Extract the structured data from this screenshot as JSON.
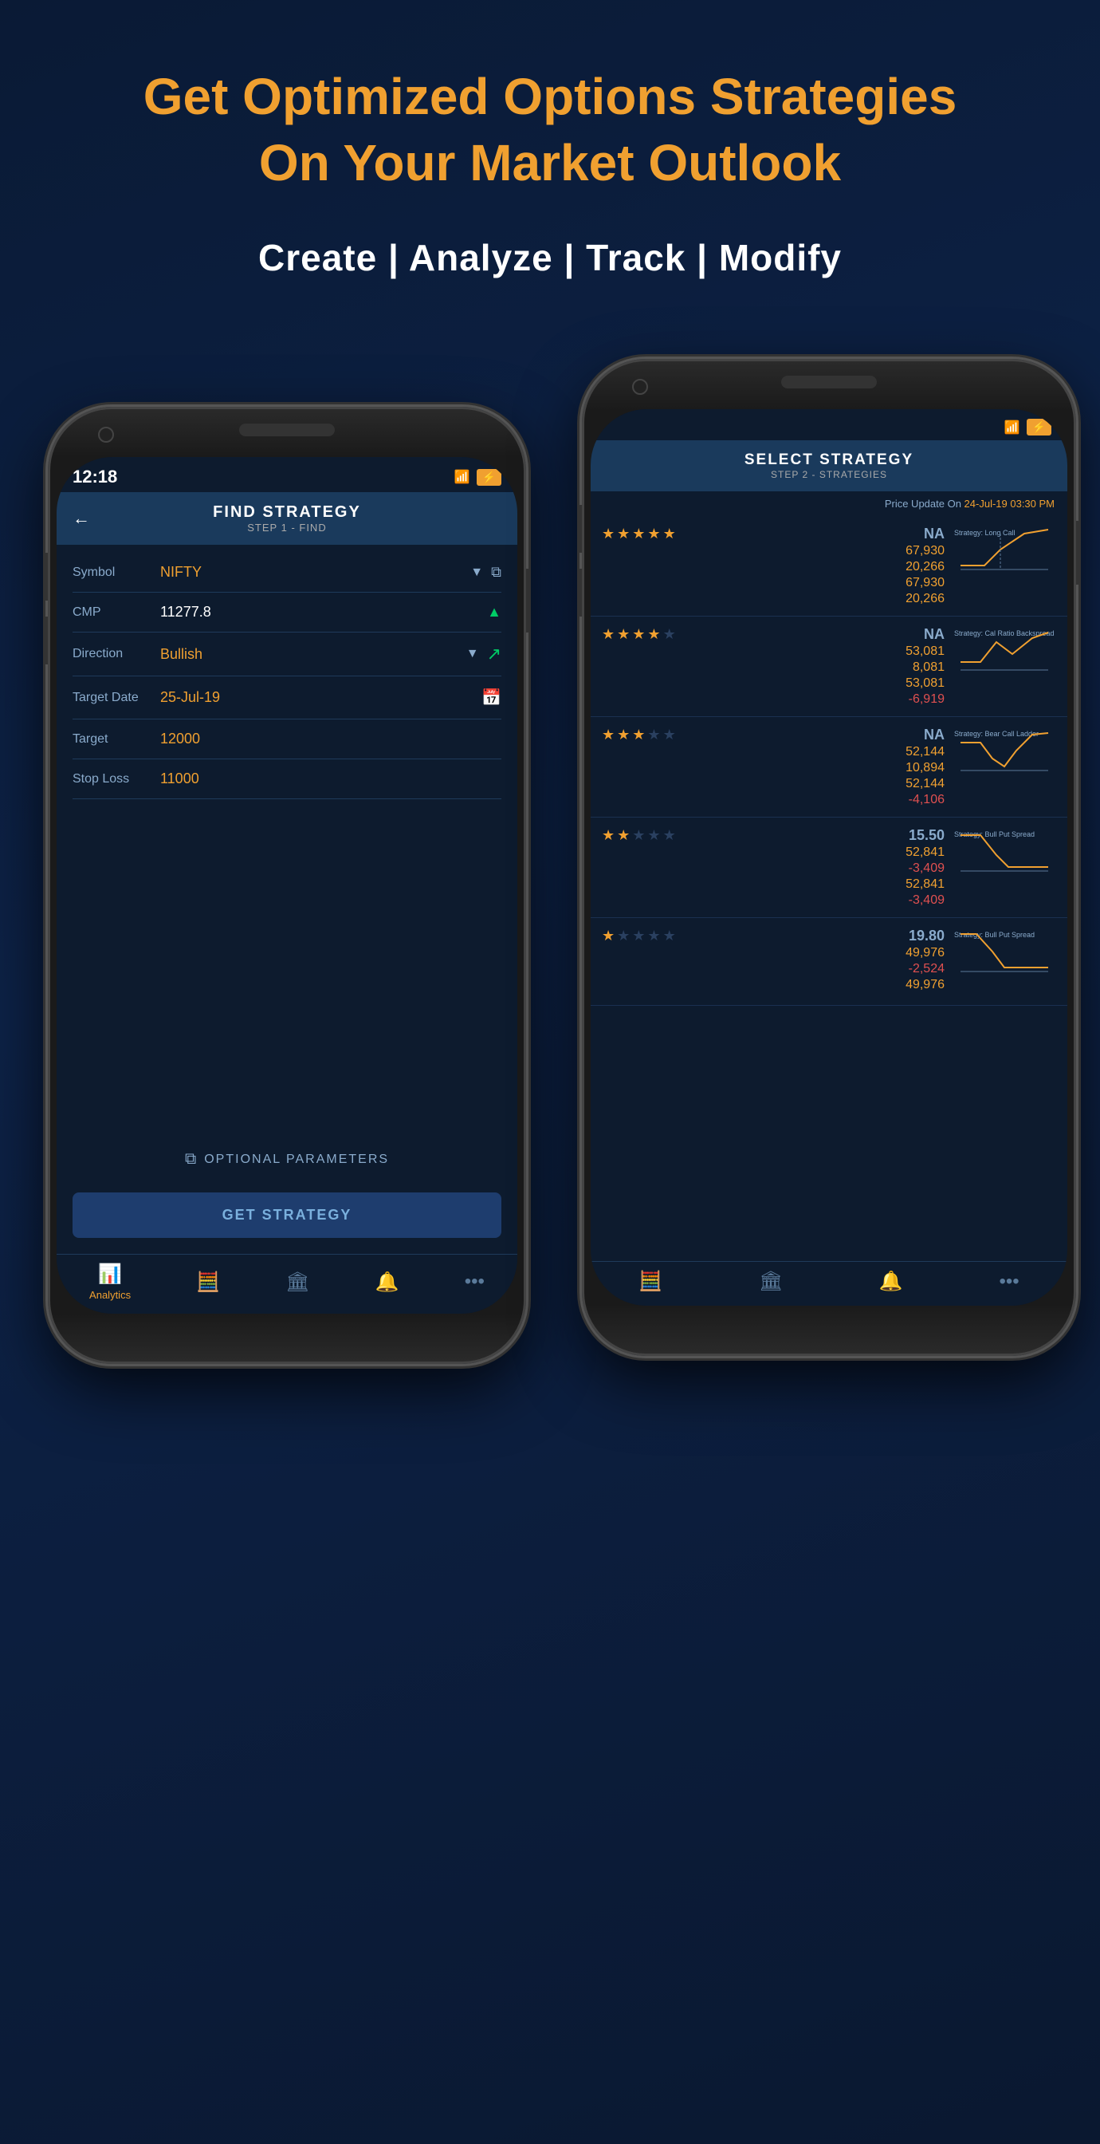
{
  "header": {
    "line1_prefix": "Get ",
    "line1_highlight": "Optimized Options Strategies",
    "line2_prefix": "On Your ",
    "line2_highlight": "Market Outlook",
    "tagline": "Create | Analyze | Track | Modify"
  },
  "phone_left": {
    "status": {
      "time": "12:18",
      "wifi": "WiFi",
      "battery": "⚡"
    },
    "app_header": {
      "title": "FIND STRATEGY",
      "subtitle": "STEP 1 - FIND",
      "back_icon": "←"
    },
    "fields": [
      {
        "label": "Symbol",
        "value": "NIFTY",
        "type": "orange",
        "has_arrow": true,
        "has_icon": "copy"
      },
      {
        "label": "CMP",
        "value": "11277.8",
        "type": "white",
        "has_arrow": false,
        "has_icon": "up-green"
      },
      {
        "label": "Direction",
        "value": "Bullish",
        "type": "orange",
        "has_arrow": true,
        "has_icon": "bull"
      },
      {
        "label": "Target Date",
        "value": "25-Jul-19",
        "type": "orange",
        "has_arrow": false,
        "has_icon": "calendar"
      },
      {
        "label": "Target",
        "value": "12000",
        "type": "orange",
        "has_arrow": false,
        "has_icon": ""
      },
      {
        "label": "Stop Loss",
        "value": "11000",
        "type": "orange",
        "has_arrow": false,
        "has_icon": ""
      }
    ],
    "optional_params": "OPTIONAL PARAMETERS",
    "get_strategy_btn": "GET STRATEGY",
    "nav": [
      {
        "icon": "📊",
        "label": "Analytics",
        "active": true
      },
      {
        "icon": "🧮",
        "label": "",
        "active": false
      },
      {
        "icon": "🏛",
        "label": "",
        "active": false
      },
      {
        "icon": "🔔",
        "label": "",
        "active": false
      },
      {
        "icon": "•••",
        "label": "",
        "active": false
      }
    ]
  },
  "phone_right": {
    "status": {
      "wifi": "WiFi",
      "battery": "⚡"
    },
    "app_header": {
      "title": "SELECT STRATEGY",
      "subtitle": "STEP 2 - STRATEGIES"
    },
    "price_update": {
      "prefix": "Price Update On ",
      "date": "24-Jul-19 03:30 PM"
    },
    "strategies": [
      {
        "name": "Long Call",
        "stars": 5,
        "na_label": "NA",
        "vals": [
          "67,930",
          "20,266",
          "67,930",
          "20,266"
        ],
        "val_colors": [
          "orange",
          "orange",
          "orange",
          "orange"
        ],
        "chart_type": "long_call"
      },
      {
        "name": "Call Ratio Backspread",
        "stars": 4,
        "na_label": "NA",
        "vals": [
          "53,081",
          "8,081",
          "53,081",
          "-6,919"
        ],
        "val_colors": [
          "orange",
          "orange",
          "orange",
          "red"
        ],
        "chart_type": "call_ratio"
      },
      {
        "name": "Bear Call Ladder",
        "stars": 3,
        "na_label": "NA",
        "vals": [
          "52,144",
          "10,894",
          "52,144",
          "-4,106"
        ],
        "val_colors": [
          "orange",
          "orange",
          "orange",
          "red"
        ],
        "chart_type": "bear_call"
      },
      {
        "name": "Bull Put Spread",
        "stars": 2,
        "na_label": "15.50",
        "vals": [
          "52,841",
          "-3,409",
          "52,841",
          "-3,409"
        ],
        "val_colors": [
          "orange",
          "red",
          "orange",
          "red"
        ],
        "chart_type": "bull_put"
      },
      {
        "name": "Bull Put Spread",
        "stars": 1,
        "na_label": "19.80",
        "vals": [
          "49,976",
          "-2,524",
          "49,976"
        ],
        "val_colors": [
          "orange",
          "red",
          "orange"
        ],
        "chart_type": "bull_put2"
      }
    ],
    "nav": [
      {
        "icon": "🧮",
        "active": false
      },
      {
        "icon": "🏛",
        "active": false
      },
      {
        "icon": "🔔",
        "active": false
      },
      {
        "icon": "•••",
        "active": false
      }
    ]
  }
}
